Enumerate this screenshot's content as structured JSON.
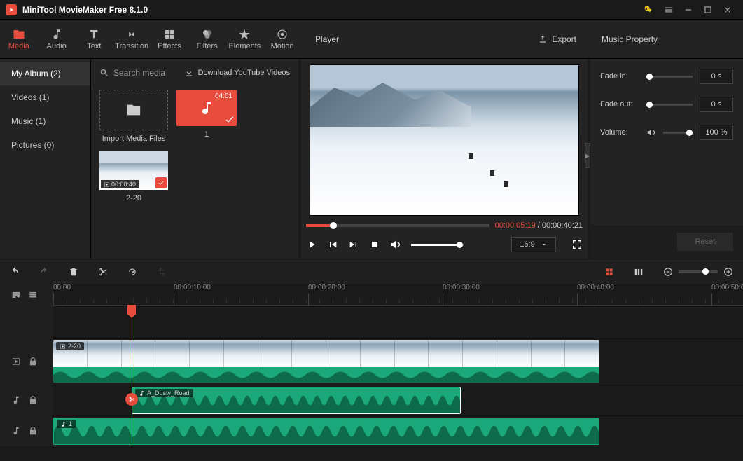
{
  "titlebar": {
    "title": "MiniTool MovieMaker Free 8.1.0"
  },
  "tooltabs": {
    "media": "Media",
    "audio": "Audio",
    "text": "Text",
    "transition": "Transition",
    "effects": "Effects",
    "filters": "Filters",
    "elements": "Elements",
    "motion": "Motion"
  },
  "player_header": {
    "title": "Player",
    "export": "Export"
  },
  "props_header": {
    "title": "Music Property"
  },
  "sidebar": {
    "items": [
      {
        "label": "My Album (2)"
      },
      {
        "label": "Videos (1)"
      },
      {
        "label": "Music (1)"
      },
      {
        "label": "Pictures (0)"
      }
    ]
  },
  "medialib": {
    "search_ph": "Search media",
    "download_yt": "Download YouTube Videos",
    "import_label": "Import Media Files",
    "music_dur": "04:01",
    "music_label": "1",
    "video_time": "00:00:40",
    "video_label": "2-20"
  },
  "player": {
    "current": "00:00:05:19",
    "sep": " / ",
    "total": "00:00:40:21",
    "aspect": "16:9"
  },
  "props": {
    "fadein_label": "Fade in:",
    "fadein_val": "0 s",
    "fadeout_label": "Fade out:",
    "fadeout_val": "0 s",
    "volume_label": "Volume:",
    "volume_val": "100 %",
    "reset": "Reset"
  },
  "ruler": {
    "t0": "00:00",
    "t1": "00:00:10:00",
    "t2": "00:00:20:00",
    "t3": "00:00:30:00",
    "t4": "00:00:40:00",
    "t5": "00:00:50:00"
  },
  "clips": {
    "video_label": "2-20",
    "audio1_label": "A_Dusty_Road",
    "audio2_label": "1"
  }
}
